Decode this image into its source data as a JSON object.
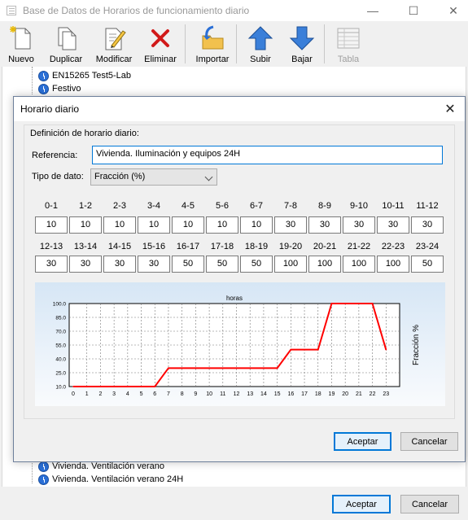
{
  "window": {
    "title": "Base de Datos de Horarios de funcionamiento diario",
    "controls": [
      "—",
      "☐",
      "✕"
    ]
  },
  "toolbar": [
    {
      "label": "Nuevo",
      "icon": "new-document-icon"
    },
    {
      "label": "Duplicar",
      "icon": "duplicate-icon"
    },
    {
      "label": "Modificar",
      "icon": "edit-icon"
    },
    {
      "label": "Eliminar",
      "icon": "delete-icon"
    },
    {
      "label": "Importar",
      "icon": "import-icon"
    },
    {
      "label": "Subir",
      "icon": "arrow-up-icon"
    },
    {
      "label": "Bajar",
      "icon": "arrow-down-icon"
    },
    {
      "label": "Tabla",
      "icon": "table-icon",
      "disabled": true
    }
  ],
  "tree": {
    "top_items": [
      "EN15265 Test5-Lab",
      "Festivo"
    ],
    "bottom_items": [
      "Vivienda. Ventilación verano",
      "Vivienda. Ventilación verano 24H"
    ]
  },
  "footer": {
    "accept": "Aceptar",
    "cancel": "Cancelar"
  },
  "dialog": {
    "title": "Horario diario",
    "close": "✕",
    "group_label": "Definición de horario diario:",
    "ref_label": "Referencia:",
    "ref_value": "Vivienda. Iluminación y equipos 24H",
    "tipo_label": "Tipo de dato:",
    "tipo_value": "Fracción (%)",
    "accept": "Aceptar",
    "cancel": "Cancelar",
    "hours_row1": [
      "0-1",
      "1-2",
      "2-3",
      "3-4",
      "4-5",
      "5-6",
      "6-7",
      "7-8",
      "8-9",
      "9-10",
      "10-11",
      "11-12"
    ],
    "values_row1": [
      "10",
      "10",
      "10",
      "10",
      "10",
      "10",
      "10",
      "30",
      "30",
      "30",
      "30",
      "30"
    ],
    "hours_row2": [
      "12-13",
      "13-14",
      "14-15",
      "15-16",
      "16-17",
      "17-18",
      "18-19",
      "19-20",
      "20-21",
      "21-22",
      "22-23",
      "23-24"
    ],
    "values_row2": [
      "30",
      "30",
      "30",
      "30",
      "50",
      "50",
      "50",
      "100",
      "100",
      "100",
      "100",
      "50"
    ]
  },
  "chart_data": {
    "type": "line",
    "title": "horas",
    "ylabel": "Fracción %",
    "xlabel": "",
    "x": [
      0,
      1,
      2,
      3,
      4,
      5,
      6,
      7,
      8,
      9,
      10,
      11,
      12,
      13,
      14,
      15,
      16,
      17,
      18,
      19,
      20,
      21,
      22,
      23
    ],
    "xlim": [
      -0.3,
      24
    ],
    "ylim": [
      10,
      100
    ],
    "yticks": [
      "10.0",
      "25.0",
      "40.0",
      "55.0",
      "70.0",
      "85.0",
      "100.0"
    ],
    "xticks": [
      "0",
      "1",
      "2",
      "3",
      "4",
      "5",
      "6",
      "7",
      "8",
      "9",
      "10",
      "11",
      "12",
      "13",
      "14",
      "15",
      "16",
      "17",
      "18",
      "19",
      "20",
      "21",
      "22",
      "23"
    ],
    "series": [
      {
        "color": "#ff0000",
        "values": [
          10,
          10,
          10,
          10,
          10,
          10,
          10,
          30,
          30,
          30,
          30,
          30,
          30,
          30,
          30,
          30,
          50,
          50,
          50,
          100,
          100,
          100,
          100,
          50
        ]
      }
    ],
    "grid": true
  }
}
